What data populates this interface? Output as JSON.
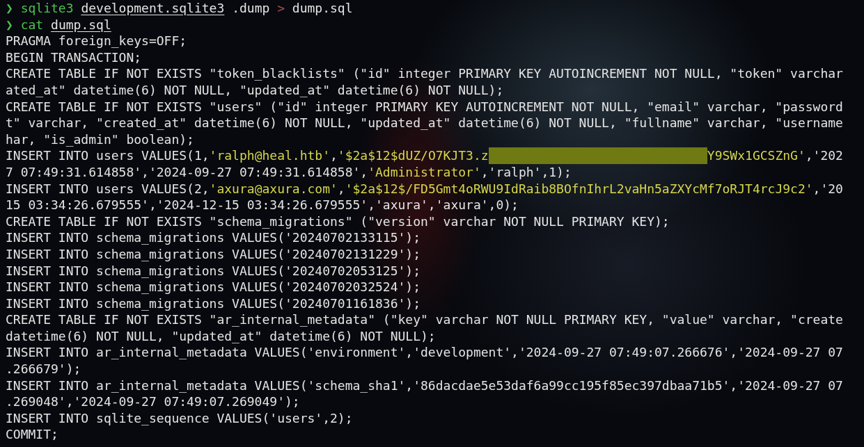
{
  "terminal": {
    "lines": [
      {
        "segments": [
          {
            "kind": "prompt",
            "text": "❯ "
          },
          {
            "kind": "command",
            "text": "sqlite3 "
          },
          {
            "kind": "path",
            "text": "development.sqlite3"
          },
          {
            "kind": "plain",
            "text": " .dump "
          },
          {
            "kind": "operator",
            "text": ">"
          },
          {
            "kind": "plain",
            "text": " dump.sql"
          }
        ]
      },
      {
        "segments": [
          {
            "kind": "prompt",
            "text": "❯ "
          },
          {
            "kind": "command",
            "text": "cat "
          },
          {
            "kind": "path",
            "text": "dump.sql"
          }
        ]
      },
      {
        "segments": [
          {
            "kind": "plain",
            "text": "PRAGMA foreign_keys=OFF;"
          }
        ]
      },
      {
        "segments": [
          {
            "kind": "plain",
            "text": "BEGIN TRANSACTION;"
          }
        ]
      },
      {
        "segments": [
          {
            "kind": "plain",
            "text": "CREATE TABLE IF NOT EXISTS \"token_blacklists\" (\"id\" integer PRIMARY KEY AUTOINCREMENT NOT NULL, \"token\" varchar"
          }
        ]
      },
      {
        "segments": [
          {
            "kind": "plain",
            "text": "ated_at\" datetime(6) NOT NULL, \"updated_at\" datetime(6) NOT NULL);"
          }
        ]
      },
      {
        "segments": [
          {
            "kind": "plain",
            "text": "CREATE TABLE IF NOT EXISTS \"users\" (\"id\" integer PRIMARY KEY AUTOINCREMENT NOT NULL, \"email\" varchar, \"password"
          }
        ]
      },
      {
        "segments": [
          {
            "kind": "plain",
            "text": "t\" varchar, \"created_at\" datetime(6) NOT NULL, \"updated_at\" datetime(6) NOT NULL, \"fullname\" varchar, \"username"
          }
        ]
      },
      {
        "segments": [
          {
            "kind": "plain",
            "text": "har, \"is_admin\" boolean);"
          }
        ]
      },
      {
        "segments": [
          {
            "kind": "plain",
            "text": "INSERT INTO users VALUES(1,"
          },
          {
            "kind": "string",
            "text": "'ralph@heal.htb'"
          },
          {
            "kind": "plain",
            "text": ","
          },
          {
            "kind": "string",
            "text": "'$2a$12$dUZ/O7KJT3.z"
          },
          {
            "kind": "redacted"
          },
          {
            "kind": "string",
            "text": "Y9SWx1GCSZnG'"
          },
          {
            "kind": "plain",
            "text": ",'202"
          }
        ]
      },
      {
        "segments": [
          {
            "kind": "plain",
            "text": "7 07:49:31.614858','2024-09-27 07:49:31.614858',"
          },
          {
            "kind": "string",
            "text": "'Administrator'"
          },
          {
            "kind": "plain",
            "text": ",'ralph',1);"
          }
        ]
      },
      {
        "segments": [
          {
            "kind": "plain",
            "text": "INSERT INTO users VALUES(2,"
          },
          {
            "kind": "string",
            "text": "'axura@axura.com'"
          },
          {
            "kind": "plain",
            "text": ","
          },
          {
            "kind": "string",
            "text": "'$2a$12$/FD5Gmt4oRWU9IdRaib8BOfnIhrL2vaHn5aZXYcMf7oRJT4rcJ9c2'"
          },
          {
            "kind": "plain",
            "text": ",'20"
          }
        ]
      },
      {
        "segments": [
          {
            "kind": "plain",
            "text": "15 03:34:26.679555','2024-12-15 03:34:26.679555','axura','axura',0);"
          }
        ]
      },
      {
        "segments": [
          {
            "kind": "plain",
            "text": "CREATE TABLE IF NOT EXISTS \"schema_migrations\" (\"version\" varchar NOT NULL PRIMARY KEY);"
          }
        ]
      },
      {
        "segments": [
          {
            "kind": "plain",
            "text": "INSERT INTO schema_migrations VALUES('20240702133115');"
          }
        ]
      },
      {
        "segments": [
          {
            "kind": "plain",
            "text": "INSERT INTO schema_migrations VALUES('20240702131229');"
          }
        ]
      },
      {
        "segments": [
          {
            "kind": "plain",
            "text": "INSERT INTO schema_migrations VALUES('20240702053125');"
          }
        ]
      },
      {
        "segments": [
          {
            "kind": "plain",
            "text": "INSERT INTO schema_migrations VALUES('20240702032524');"
          }
        ]
      },
      {
        "segments": [
          {
            "kind": "plain",
            "text": "INSERT INTO schema_migrations VALUES('20240701161836');"
          }
        ]
      },
      {
        "segments": [
          {
            "kind": "plain",
            "text": "CREATE TABLE IF NOT EXISTS \"ar_internal_metadata\" (\"key\" varchar NOT NULL PRIMARY KEY, \"value\" varchar, \"create"
          }
        ]
      },
      {
        "segments": [
          {
            "kind": "plain",
            "text": "datetime(6) NOT NULL, \"updated_at\" datetime(6) NOT NULL);"
          }
        ]
      },
      {
        "segments": [
          {
            "kind": "plain",
            "text": "INSERT INTO ar_internal_metadata VALUES('environment','development','2024-09-27 07:49:07.266676','2024-09-27 07"
          }
        ]
      },
      {
        "segments": [
          {
            "kind": "plain",
            "text": ".266679');"
          }
        ]
      },
      {
        "segments": [
          {
            "kind": "plain",
            "text": "INSERT INTO ar_internal_metadata VALUES('schema_sha1','86dacdae5e53daf6a99cc195f85ec397dbaa71b5','2024-09-27 07"
          }
        ]
      },
      {
        "segments": [
          {
            "kind": "plain",
            "text": ".269048','2024-09-27 07:49:07.269049');"
          }
        ]
      },
      {
        "segments": [
          {
            "kind": "plain",
            "text": "INSERT INTO sqlite_sequence VALUES('users',2);"
          }
        ]
      },
      {
        "segments": [
          {
            "kind": "plain",
            "text": "COMMIT;"
          }
        ]
      }
    ]
  }
}
